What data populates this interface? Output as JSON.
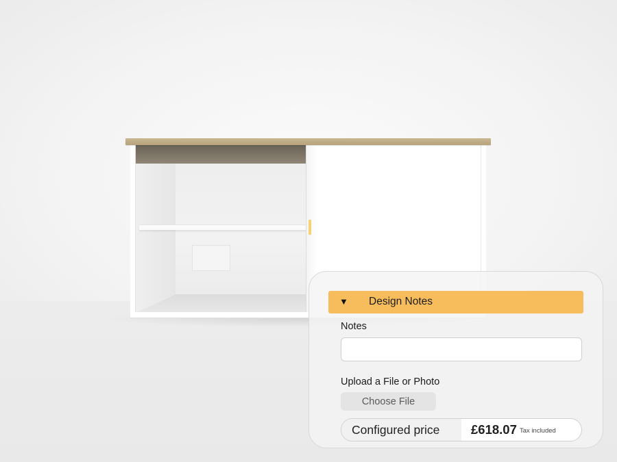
{
  "design_notes": {
    "toggle_glyph": "▼",
    "title": "Design Notes",
    "accent_color": "#f7bd5c",
    "notes_label": "Notes",
    "notes_value": "",
    "upload_label": "Upload a File or Photo",
    "choose_file_label": "Choose File"
  },
  "price": {
    "label": "Configured price",
    "value": "£618.07",
    "tax_note": "Tax included"
  },
  "product": {
    "top_color": "#b6a27b",
    "handle_color": "#f3d373",
    "body_color": "#ffffff"
  }
}
